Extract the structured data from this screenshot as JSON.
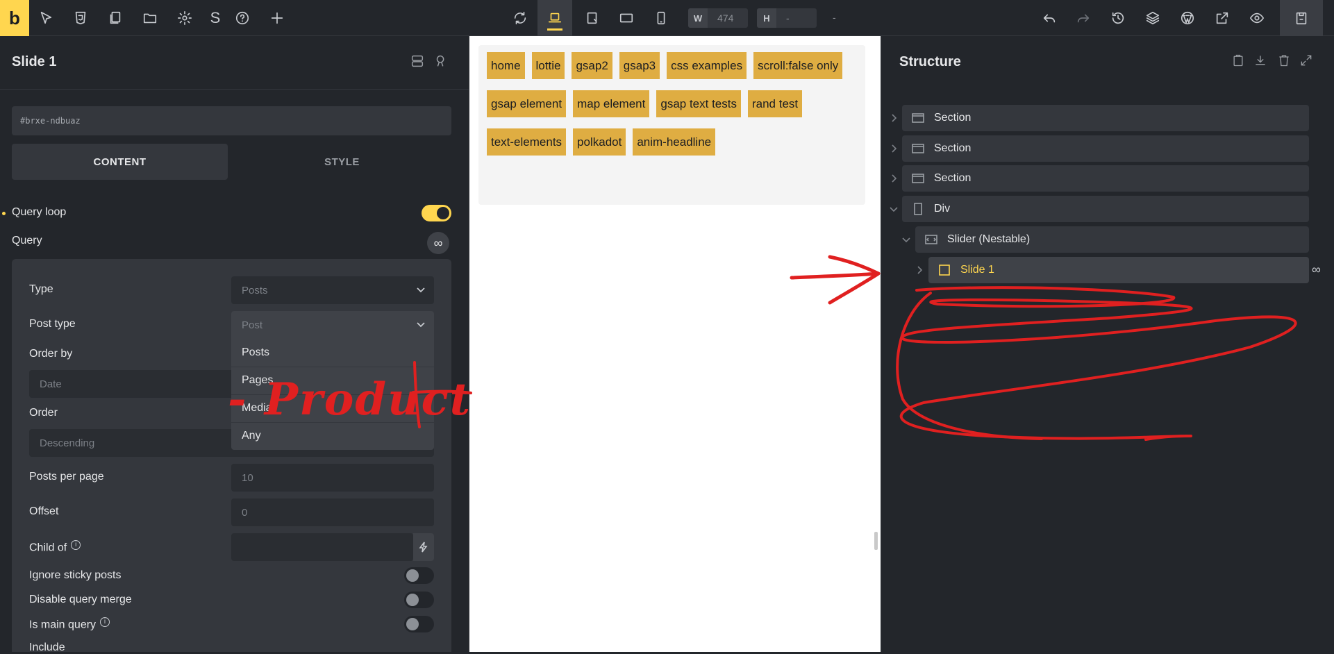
{
  "toolbar": {
    "logo": "b",
    "s_label": "S",
    "width_label": "W",
    "width_value": "474",
    "height_label": "H",
    "height_value": "-",
    "extra_value": "-"
  },
  "left_panel": {
    "title": "Slide 1",
    "element_id": "#brxe-ndbuaz",
    "tabs": {
      "content": "CONTENT",
      "style": "STYLE"
    },
    "query_loop_label": "Query loop",
    "query_label": "Query",
    "query_symbol": "∞",
    "query": {
      "type_label": "Type",
      "type_value": "Posts",
      "post_type_label": "Post type",
      "post_type_value": "Post",
      "post_type_options": [
        "Posts",
        "Pages",
        "Media",
        "Any"
      ],
      "order_by_label": "Order by",
      "order_by_value": "Date",
      "order_label": "Order",
      "order_value": "Descending",
      "posts_per_page_label": "Posts per page",
      "posts_per_page_value": "10",
      "offset_label": "Offset",
      "offset_value": "0",
      "child_of_label": "Child of",
      "ignore_sticky_label": "Ignore sticky posts",
      "disable_merge_label": "Disable query merge",
      "is_main_label": "Is main query",
      "include_label": "Include"
    }
  },
  "canvas": {
    "menu_items": [
      "home",
      "lottie",
      "gsap2",
      "gsap3",
      "css examples",
      "scroll:false only",
      "gsap element",
      "map element",
      "gsap text tests",
      "rand test",
      "text-elements",
      "polkadot",
      "anim-headline"
    ]
  },
  "structure": {
    "title": "Structure",
    "nodes": [
      {
        "label": "Section"
      },
      {
        "label": "Section"
      },
      {
        "label": "Section"
      },
      {
        "label": "Div"
      },
      {
        "label": "Slider (Nestable)"
      },
      {
        "label": "Slide 1"
      }
    ],
    "active_symbol": "∞"
  },
  "annotation": {
    "handwritten_text": "- Product",
    "color": "#e02020"
  },
  "colors": {
    "accent": "#ffd64f",
    "menu_tag": "#dfad42",
    "panel": "#23262b"
  }
}
